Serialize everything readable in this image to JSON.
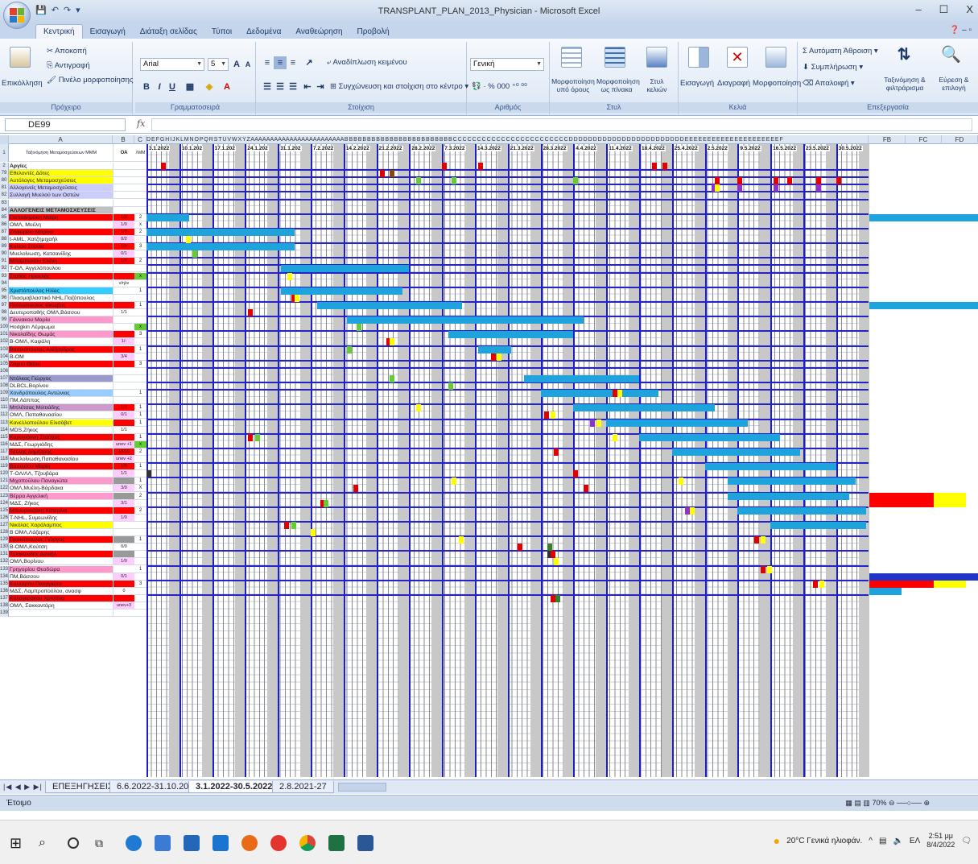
{
  "window": {
    "title": "TRANSPLANT_PLAN_2013_Physician - Microsoft Excel",
    "controls": [
      "–",
      "☐",
      "X"
    ]
  },
  "ribbon": {
    "tabs": [
      "Κεντρική",
      "Εισαγωγή",
      "Διάταξη σελίδας",
      "Τύποι",
      "Δεδομένα",
      "Αναθεώρηση",
      "Προβολή"
    ],
    "active_tab": "Κεντρική",
    "clipboard": {
      "paste": "Επικόλληση",
      "cut": "Αποκοπή",
      "copy": "Αντιγραφή",
      "format_painter": "Πινέλο μορφοποίησης",
      "label": "Πρόχειρο"
    },
    "font": {
      "name": "Arial",
      "size": "5",
      "label": "Γραμματοσειρά"
    },
    "alignment": {
      "wrap": "Αναδίπλωση κειμένου",
      "merge": "Συγχώνευση και στοίχιση στο κέντρο",
      "label": "Στοίχιση"
    },
    "number": {
      "format": "Γενική",
      "label": "Αριθμός"
    },
    "styles": {
      "conditional": "Μορφοποίηση υπό όρους",
      "table": "Μορφοποίηση ως πίνακα",
      "cell": "Στυλ κελιών",
      "label": "Στυλ"
    },
    "cells": {
      "insert": "Εισαγωγή",
      "delete": "Διαγραφή",
      "format": "Μορφοποίηση",
      "label": "Κελιά"
    },
    "editing": {
      "autosum": "Αυτόματη Άθροιση",
      "fill": "Συμπλήρωση",
      "clear": "Απαλοιφή",
      "sort": "Ταξινόμηση & φιλτράρισμα",
      "find": "Εύρεση & επιλογή",
      "label": "Επεξεργασία"
    }
  },
  "formula_bar": {
    "name_box": "DE99",
    "fx": "fx",
    "value": ""
  },
  "columns": {
    "a": "A",
    "b": "B",
    "c": "C",
    "right": [
      "FB",
      "FC",
      "FD"
    ]
  },
  "header_row": {
    "a1": "Ταξινόμηση Μεταμοσχεύσεων ΜΜΜ",
    "b1": "ΟΑ",
    "c1": "ΛΜΜ"
  },
  "dates": [
    "3.1.2022",
    "10.1.202",
    "17.1.202",
    "24.1.202",
    "31.1.202",
    "7.2.2022",
    "14.2.2022",
    "21.2.2022",
    "28.2.2022",
    "7.3.2022",
    "14.3.2022",
    "21.3.2022",
    "28.3.2022",
    "4.4.2022",
    "11.4.2022",
    "18.4.2022",
    "25.4.2022",
    "2.5.2022",
    "9.5.2022",
    "16.5.2022",
    "23.5.2022",
    "30.5.2022"
  ],
  "rows": [
    {
      "n": "2",
      "a": "Αργίες",
      "a_bg": "#ffffff",
      "bold": true
    },
    {
      "n": "79",
      "a": "Εθελοντές Δότες",
      "a_bg": "#ffff00"
    },
    {
      "n": "80",
      "a": "Αυτόλογες Μεταμοσχεύσεις",
      "a_bg": "#ffff00"
    },
    {
      "n": "81",
      "a": "Αλλογενείς Μεταμοσχεύσεις",
      "a_bg": "#ccccff"
    },
    {
      "n": "82",
      "a": "Συλλογή Μυελού των Οστών",
      "a_bg": "#ccccff"
    },
    {
      "n": "83",
      "a": ""
    },
    {
      "n": "84",
      "a": "ΑΛΛΟΓΕΝΕΙΣ ΜΕΤΑΜΟΣΧΕΥΣΕΙΣ",
      "a_bg": "#c0c0c0",
      "bold": true
    },
    {
      "n": "85",
      "a": "Παπαδημάκη Μαίρη",
      "a_bg": "#ff0000",
      "b": "1/0",
      "b_bg": "#ff0000",
      "c": "2"
    },
    {
      "n": "86",
      "a": "ΟΜΛ, Μυέλη",
      "b": "1/0",
      "b_bg": "#ffccff",
      "c": "x"
    },
    {
      "n": "87",
      "a": "Ζαφειρίου Μαρίνα",
      "a_bg": "#ff0000",
      "b": "1/0",
      "b_bg": "#ff0000",
      "c": "2"
    },
    {
      "n": "88",
      "a": "t-AML, Χατζημιχαήλ",
      "b": "0/2",
      "b_bg": "#ffccff"
    },
    {
      "n": "89",
      "a": "Κυλίου Στέλλα",
      "a_bg": "#ff0000",
      "b": "1/0",
      "b_bg": "#ff0000",
      "c": "3"
    },
    {
      "n": "90",
      "a": "Μυελοίνωση, Κατσανίδης",
      "b": "0/1",
      "b_bg": "#ffccff"
    },
    {
      "n": "91",
      "a": "Μπαμπακίου Ελένη",
      "a_bg": "#ff0000",
      "b": "1/0",
      "b_bg": "#ff0000",
      "c": "2"
    },
    {
      "n": "92",
      "a": "Τ-ΟΛ, Αγγελόπουλου"
    },
    {
      "n": "93",
      "a": "Σταθάς Ηρακλής",
      "a_bg": "#ff0000",
      "b": "",
      "b_bg": "#ff0000",
      "c": "x",
      "c_bg": "#66cc33"
    },
    {
      "n": "94",
      "a": "",
      "b": "ν/ηλν"
    },
    {
      "n": "95",
      "a": "Χριστόπουλος Ηλίας",
      "a_bg": "#33ccff",
      "c": "1"
    },
    {
      "n": "96",
      "a": "Πλασμαβλαστικό NHL,Παζόπουλος"
    },
    {
      "n": "97",
      "a": "Πολίτοπουλος Ιάκωβος",
      "a_bg": "#ff0000",
      "b": "",
      "b_bg": "#ff0000",
      "c": "1"
    },
    {
      "n": "98",
      "a": "Δευτεροπαθής ΟΜΛ,Βάσσου",
      "b": "1/1"
    },
    {
      "n": "99",
      "a": "Γάννακου Μαρία",
      "a_bg": "#ff99cc"
    },
    {
      "n": "100",
      "a": "Hodgkin Λέμφωμα",
      "c": "x",
      "c_bg": "#66cc33"
    },
    {
      "n": "101",
      "a": "Νικολαΐδης Θωμάς",
      "a_bg": "#ff99cc",
      "b": "",
      "b_bg": "#ff0000",
      "c": "3"
    },
    {
      "n": "102",
      "a": "Β-ΟΜΛ, Καψάλη",
      "b": "1/-",
      "b_bg": "#ffccff"
    },
    {
      "n": "103",
      "a": "Βασιλόπουλος Αλέξανδρος",
      "a_bg": "#ff0000",
      "b": "",
      "b_bg": "#ff0000",
      "c": "1"
    },
    {
      "n": "104",
      "a": "Β-ΟΜ",
      "b": "3/4",
      "b_bg": "#ffccff"
    },
    {
      "n": "105",
      "a": "Ζαχου Θείου",
      "a_bg": "#ff0000",
      "b": "",
      "b_bg": "#ff0000",
      "c": "3"
    },
    {
      "n": "106",
      "a": ""
    },
    {
      "n": "107",
      "a": "Ντόλκας Γιώργος",
      "a_bg": "#9999cc"
    },
    {
      "n": "108",
      "a": "DLBCL,Βορίνου"
    },
    {
      "n": "109",
      "a": "Χονδρόπουλος Αντώνιος",
      "a_bg": "#99ccff",
      "c": "1"
    },
    {
      "n": "110",
      "a": "ΠΜ,Λάππας"
    },
    {
      "n": "111",
      "a": "Μπλέτσας Μιλτιάδης",
      "a_bg": "#cc99cc",
      "b": "1/1",
      "b_bg": "#ff0000",
      "c": "1"
    },
    {
      "n": "112",
      "a": "ΟΜΛ, Παπαθανασίου",
      "b": "0/1",
      "b_bg": "#ffccff",
      "c": "1"
    },
    {
      "n": "113",
      "a": "Κανελλοπούλου Ελισάβετ",
      "a_bg": "#ffff00",
      "b": "",
      "b_bg": "#ff0000",
      "c": "1"
    },
    {
      "n": "114",
      "a": "MDS,Ζήκος",
      "b": "1/1"
    },
    {
      "n": "115",
      "a": "Καραγιάννη Σταύρος",
      "a_bg": "#ff0000",
      "b": "",
      "b_bg": "#ff0000",
      "c": "1"
    },
    {
      "n": "116",
      "a": "ΜΔΣ, Γεωργιάδης",
      "b": "unev +1",
      "b_bg": "#ffccff",
      "c": "x",
      "c_bg": "#66cc33"
    },
    {
      "n": "117",
      "a": "Τσέλης Δημήτρης",
      "a_bg": "#ff0000",
      "b": "10/10",
      "b_bg": "#ff0000",
      "c": "2"
    },
    {
      "n": "118",
      "a": "Μυελοίνωση,Παπαθανασίου",
      "b": "unev +2",
      "b_bg": "#ffccff"
    },
    {
      "n": "119",
      "a": "Βασιλείου Μαρία",
      "a_bg": "#ff0000",
      "b": "1/0",
      "b_bg": "#ff0000",
      "c": "1"
    },
    {
      "n": "120",
      "a": "Τ-ΟΛ/ΛΛ, Τζουβάρα",
      "b": "1/1",
      "b_bg": "#ffccff"
    },
    {
      "n": "121",
      "a": "Μιχοπούλου Παναγιώτα",
      "a_bg": "#ff99cc",
      "b": "",
      "b_bg": "#999999",
      "c": "1"
    },
    {
      "n": "122",
      "a": "ΟΜΛ,Μυέλη-Βάρδακα",
      "b": "3/0",
      "b_bg": "#ffccff",
      "c": "X"
    },
    {
      "n": "123",
      "a": "Βέρρα Αγγελική",
      "a_bg": "#ff99cc",
      "b": "",
      "b_bg": "#999999",
      "c": "2"
    },
    {
      "n": "124",
      "a": "ΜΔΣ, Ζήκος",
      "b": "3/1",
      "b_bg": "#ffccff"
    },
    {
      "n": "125",
      "a": "Μπουρναζάκη Κατερίνα",
      "a_bg": "#ff0000",
      "b": "",
      "b_bg": "#ff0000",
      "c": "2"
    },
    {
      "n": "126",
      "a": "T-NHL, Συμεωνίδης",
      "b": "1/0",
      "b_bg": "#ffccff"
    },
    {
      "n": "127",
      "a": "Νικόλας Χαράλαμπος",
      "a_bg": "#ffff00"
    },
    {
      "n": "128",
      "a": "Β ΟΜΛ,Λάζαρης"
    },
    {
      "n": "129",
      "a": "Προκόπουλος Γιώργος",
      "a_bg": "#ff0000",
      "b": "",
      "b_bg": "#999999",
      "c": "1"
    },
    {
      "n": "130",
      "a": "Β-ΟΜΛ,Κούτση",
      "b": "0/0"
    },
    {
      "n": "131",
      "a": "Τσιακαλίδης Δανιήλ",
      "a_bg": "#ff0000",
      "b": "",
      "b_bg": "#999999"
    },
    {
      "n": "132",
      "a": "ΟΜΛ,Βορίνου",
      "b": "1/0",
      "b_bg": "#ffccff"
    },
    {
      "n": "133",
      "a": "Γρηγορίου Θεοδώρα",
      "a_bg": "#ff99cc",
      "c": "1"
    },
    {
      "n": "134",
      "a": "ΠΜ,Βάσσου",
      "b": "0/1",
      "b_bg": "#ffccff"
    },
    {
      "n": "135",
      "a": "Κολλάρου Παναγιώτα",
      "a_bg": "#ff0000",
      "b": "",
      "b_bg": "#ff0000",
      "c": "3"
    },
    {
      "n": "136",
      "a": "ΜΔΣ, Λαμπροπούλου, ανασφ",
      "b": "0"
    },
    {
      "n": "137",
      "a": "Καλογεράκου Χριστίνα",
      "a_bg": "#ff0000",
      "b": "",
      "b_bg": "#ff0000"
    },
    {
      "n": "138",
      "a": "ΟΜΛ, Σακκαντάρη",
      "b": "unev+3",
      "b_bg": "#ffccff"
    },
    {
      "n": "139",
      "a": ""
    }
  ],
  "sheet_tabs": [
    "ΕΠΕΞΗΓΗΣΕΙΣ",
    "6.6.2022-31.10.2022",
    "3.1.2022-30.5.2022",
    "2.8.2021-27"
  ],
  "active_sheet": "3.1.2022-30.5.2022",
  "status": {
    "ready": "Έτοιμο",
    "zoom": "70%"
  },
  "taskbar": {
    "weather": "20°C Γενικά ηλιοφάν.",
    "lang": "ΕΛ",
    "time": "2:51 μμ",
    "date": "8/4/2022"
  },
  "colors": {
    "bar": "#1fa3dc",
    "week_line": "#1c1cc8",
    "ribbon": "#dbe6f4"
  }
}
